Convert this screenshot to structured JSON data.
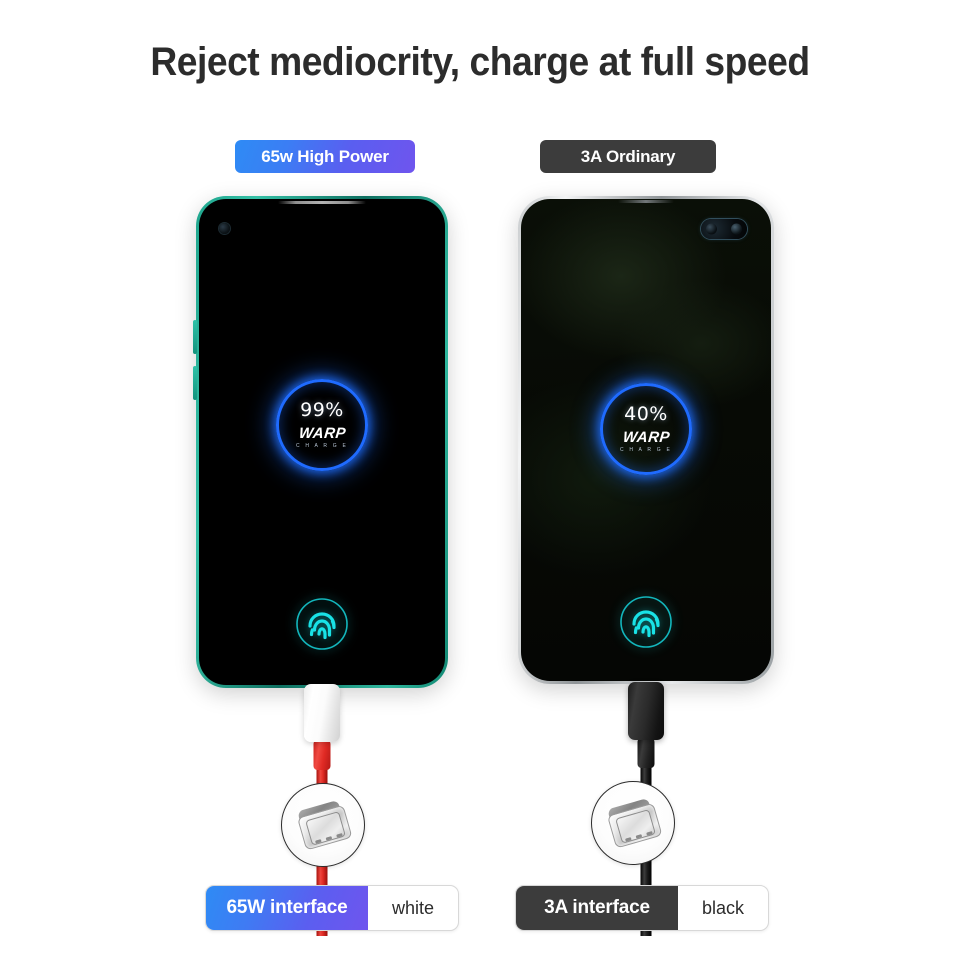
{
  "page": {
    "title": "Reject mediocrity, charge at full speed",
    "background_color": "#ffffff"
  },
  "colors": {
    "accent_blue": "#2e8bf5",
    "accent_purple": "#6f55ee",
    "dark_gray": "#3c3c3c",
    "ring_blue": "#1f6bff",
    "fingerprint_cyan": "#16dde1",
    "phone_left_frame": "#2fb79e",
    "phone_right_frame": "#c9ccce",
    "cable_red": "#e02b24",
    "cable_black": "#1e1e1e",
    "title_color": "#2c2c2c"
  },
  "comparison": {
    "left": {
      "badge_label": "65w High Power",
      "battery_percent": "99%",
      "charge_brand": "WARP",
      "charge_brand_sub": "C H A R G E",
      "fingerprint_icon": "fingerprint-icon",
      "camera_icon": "punch-hole-camera-icon",
      "plug_color_name": "white",
      "cable_color_name": "red",
      "magnifier_icon": "usb-c-connector-icon",
      "footer_main_label": "65W interface",
      "footer_alt_label": "white"
    },
    "right": {
      "badge_label": "3A Ordinary",
      "battery_percent": "40%",
      "charge_brand": "WARP",
      "charge_brand_sub": "C H A R G E",
      "fingerprint_icon": "fingerprint-icon",
      "camera_icon": "dual-punch-hole-camera-icon",
      "plug_color_name": "black",
      "cable_color_name": "black",
      "magnifier_icon": "usb-c-connector-icon",
      "footer_main_label": "3A interface",
      "footer_alt_label": "black"
    }
  }
}
